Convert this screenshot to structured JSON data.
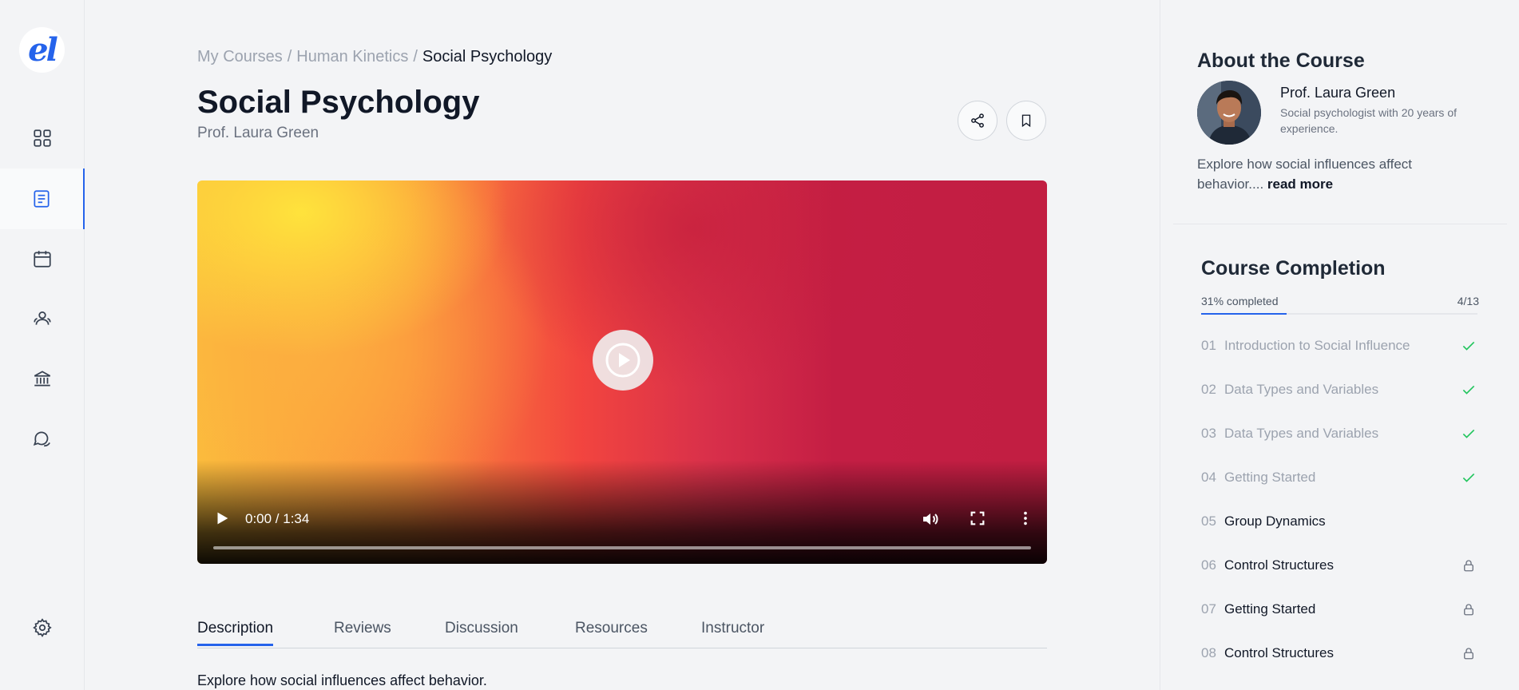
{
  "logo": {
    "text": "el"
  },
  "sidebar": {
    "items": [
      {
        "name": "dashboard",
        "icon": "grid-icon"
      },
      {
        "name": "courses",
        "icon": "book-icon",
        "active": true
      },
      {
        "name": "calendar",
        "icon": "calendar-icon"
      },
      {
        "name": "community",
        "icon": "users-icon"
      },
      {
        "name": "institution",
        "icon": "bank-icon"
      },
      {
        "name": "messages",
        "icon": "chat-icon"
      }
    ],
    "settings_icon": "gear-icon"
  },
  "breadcrumb": {
    "items": [
      "My Courses",
      "Human Kinetics"
    ],
    "separator": "/",
    "current": "Social Psychology"
  },
  "page": {
    "title": "Social Psychology",
    "instructor": "Prof. Laura Green"
  },
  "actions": {
    "share_icon": "share-icon",
    "bookmark_icon": "bookmark-icon"
  },
  "video": {
    "time": "0:00 / 1:34",
    "progress": 0
  },
  "tabs": {
    "items": [
      "Description",
      "Reviews",
      "Discussion",
      "Resources",
      "Instructor"
    ],
    "active": "Description"
  },
  "description": {
    "text": "Explore how social influences affect behavior."
  },
  "about": {
    "title": "About the Course",
    "name": "Prof. Laura Green",
    "bio": "Social psychologist with 20 years of experience.",
    "summary": "Explore how social influences affect behavior....",
    "read_more": "read more"
  },
  "completion": {
    "title": "Course Completion",
    "label": "31% completed",
    "percent": 31,
    "count": "4/13",
    "lessons": [
      {
        "num": "01",
        "title": "Introduction to Social Influence",
        "status": "done"
      },
      {
        "num": "02",
        "title": "Data Types and Variables",
        "status": "done"
      },
      {
        "num": "03",
        "title": "Data Types and Variables",
        "status": "done"
      },
      {
        "num": "04",
        "title": "Getting Started",
        "status": "done"
      },
      {
        "num": "05",
        "title": "Group Dynamics",
        "status": "current"
      },
      {
        "num": "06",
        "title": "Control Structures",
        "status": "locked"
      },
      {
        "num": "07",
        "title": "Getting Started",
        "status": "locked"
      },
      {
        "num": "08",
        "title": "Control Structures",
        "status": "locked"
      }
    ]
  },
  "colors": {
    "accent": "#2563eb",
    "check": "#22c55e",
    "background": "#f3f4f6"
  }
}
